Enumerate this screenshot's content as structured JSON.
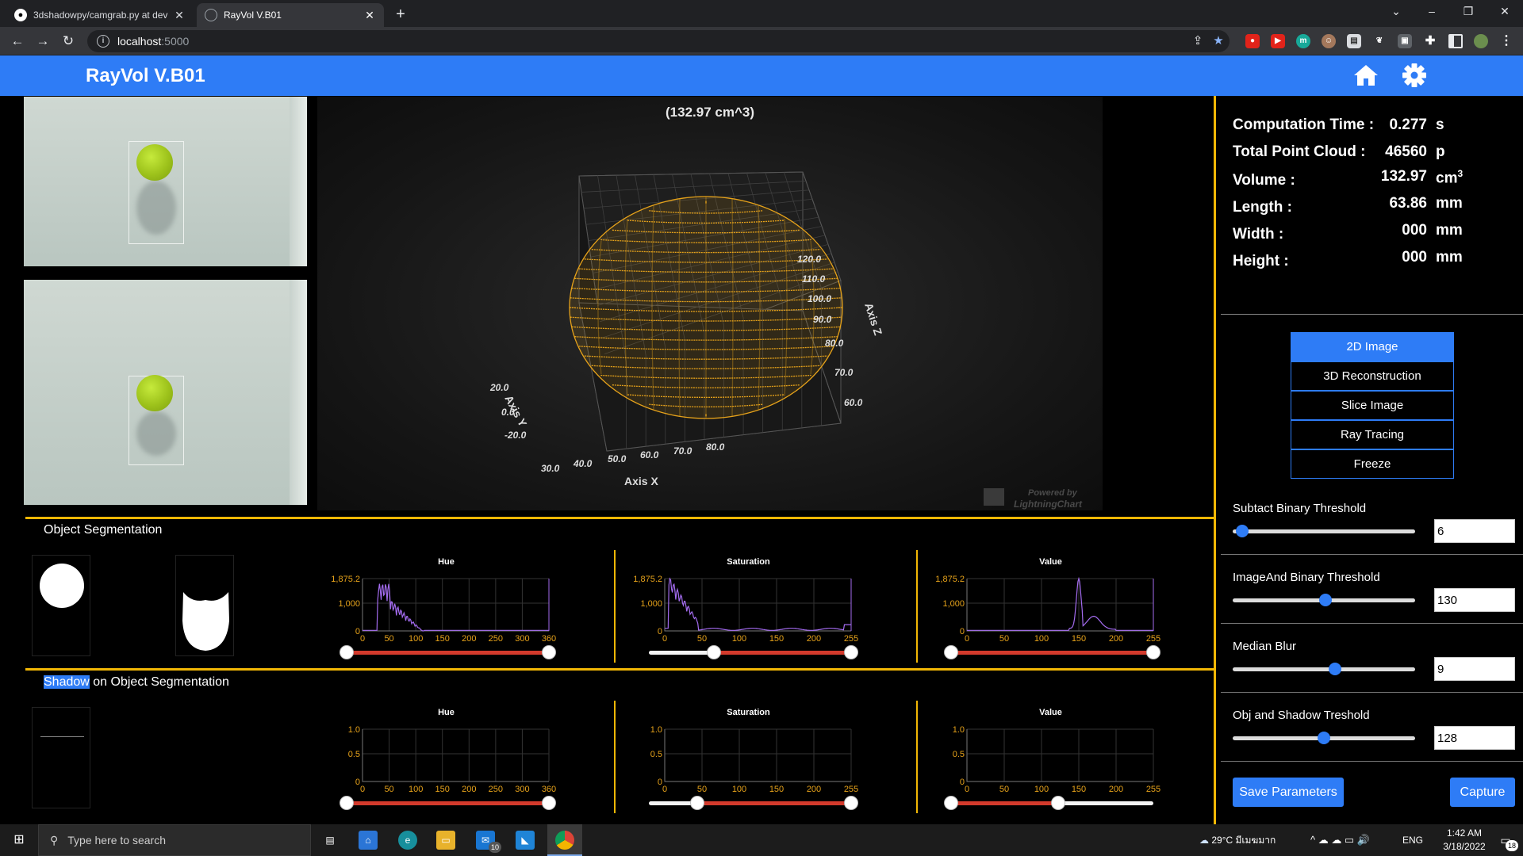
{
  "browser": {
    "tabs": [
      {
        "title": "3dshadowpy/camgrab.py at dev"
      },
      {
        "title": "RayVol V.B01"
      }
    ],
    "new_tab": "+",
    "url_host": "localhost",
    "url_port": ":5000"
  },
  "app": {
    "title": "RayVol V.B01"
  },
  "view3d": {
    "volume_readout": "(132.97 cm^3)",
    "axis_x_label": "Axis X",
    "axis_y_label": "Axis Y",
    "axis_z_label": "Axis Z",
    "x_ticks": [
      "30.0",
      "40.0",
      "50.0",
      "60.0",
      "70.0",
      "80.0"
    ],
    "y_ticks": [
      "20.0",
      "0.0",
      "-20.0"
    ],
    "z_ticks": [
      "120.0",
      "110.0",
      "100.0",
      "90.0",
      "80.0",
      "70.0",
      "60.0"
    ],
    "watermark_line1": "Powered by",
    "watermark_line2": "LightningChart"
  },
  "stats": [
    {
      "label": "Computation Time :",
      "value": "0.277",
      "unit": "s"
    },
    {
      "label": "Total Point Cloud :",
      "value": "46560",
      "unit": "p"
    },
    {
      "label": "Volume :",
      "value": "132.97",
      "unit": "cm",
      "unit_sup": "3"
    },
    {
      "label": "Length :",
      "value": "63.86",
      "unit": "mm"
    },
    {
      "label": "Width :",
      "value": "000",
      "unit": "mm"
    },
    {
      "label": "Height :",
      "value": "000",
      "unit": "mm"
    }
  ],
  "modes": [
    {
      "label": "2D Image",
      "active": true
    },
    {
      "label": "3D Reconstruction",
      "active": false
    },
    {
      "label": "Slice Image",
      "active": false
    },
    {
      "label": "Ray Tracing",
      "active": false
    },
    {
      "label": "Freeze",
      "active": false
    }
  ],
  "sliders": [
    {
      "label": "Subtact Binary Threshold",
      "value": "6",
      "fraction": 0.05
    },
    {
      "label": "ImageAnd Binary Threshold",
      "value": "130",
      "fraction": 0.51
    },
    {
      "label": "Median Blur",
      "value": "9",
      "fraction": 0.56
    },
    {
      "label": "Obj and Shadow Treshold",
      "value": "128",
      "fraction": 0.5
    }
  ],
  "actions": {
    "save": "Save Parameters",
    "capture": "Capture"
  },
  "segmentation": {
    "object_title": "Object Segmentation",
    "shadow_title_highlight": "Shadow",
    "shadow_title_rest": " on Object Segmentation"
  },
  "histograms": {
    "object": [
      {
        "title": "Hue",
        "y_ticks": [
          "1,875.2",
          "1,000",
          "0"
        ],
        "x_ticks": [
          "0",
          "50",
          "100",
          "150",
          "200",
          "250",
          "300",
          "360"
        ],
        "range": [
          0,
          1
        ]
      },
      {
        "title": "Saturation",
        "y_ticks": [
          "1,875.2",
          "1,000",
          "0"
        ],
        "x_ticks": [
          "0",
          "50",
          "100",
          "150",
          "200",
          "255"
        ],
        "range": [
          0.32,
          1
        ]
      },
      {
        "title": "Value",
        "y_ticks": [
          "1,875.2",
          "1,000",
          "0"
        ],
        "x_ticks": [
          "0",
          "50",
          "100",
          "150",
          "200",
          "255"
        ],
        "range": [
          0,
          1
        ]
      }
    ],
    "shadow": [
      {
        "title": "Hue",
        "y_ticks": [
          "1.0",
          "0.5",
          "0"
        ],
        "x_ticks": [
          "0",
          "50",
          "100",
          "150",
          "200",
          "250",
          "300",
          "360"
        ],
        "range": [
          0,
          1
        ]
      },
      {
        "title": "Saturation",
        "y_ticks": [
          "1.0",
          "0.5",
          "0"
        ],
        "x_ticks": [
          "0",
          "50",
          "100",
          "150",
          "200",
          "255"
        ],
        "range": [
          0.24,
          1
        ]
      },
      {
        "title": "Value",
        "y_ticks": [
          "1.0",
          "0.5",
          "0"
        ],
        "x_ticks": [
          "0",
          "50",
          "100",
          "150",
          "200",
          "255"
        ],
        "range": [
          0,
          0.53
        ]
      }
    ]
  },
  "taskbar": {
    "search_placeholder": "Type here to search",
    "weather": "29°C มีเมฆมาก",
    "lang": "ENG",
    "time": "1:42 AM",
    "date": "3/18/2022",
    "notif_count": "18",
    "mail_badge": "10"
  },
  "colors": {
    "accent": "#2e7cf6",
    "divider": "#f2b705",
    "pointcloud": "#e6a21a",
    "hist_line": "#a46cf0",
    "slider_sel": "#d33a2c"
  }
}
